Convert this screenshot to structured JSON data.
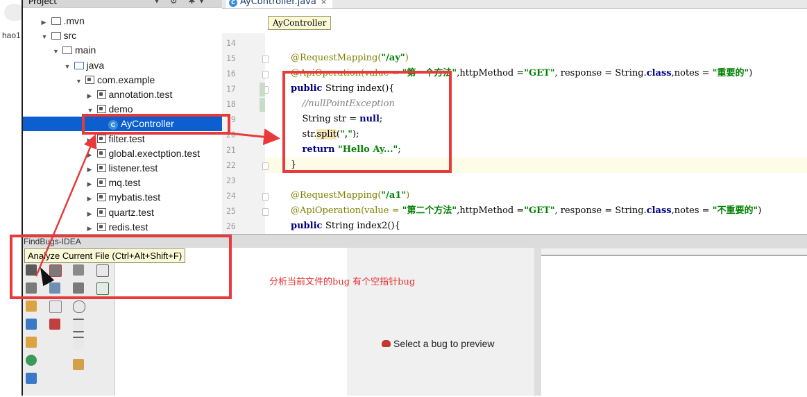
{
  "browser": {
    "partial_label": "hao1"
  },
  "project_panel": {
    "header_title": "Project",
    "header_tools": "▾ ⚙ ✱▾ ⊢",
    "tree": [
      {
        "label": ".mvn",
        "indent": 1,
        "arrow": "▶",
        "icon": "folder"
      },
      {
        "label": "src",
        "indent": 1,
        "arrow": "▼",
        "icon": "folder"
      },
      {
        "label": "main",
        "indent": 2,
        "arrow": "▼",
        "icon": "folder"
      },
      {
        "label": "java",
        "indent": 3,
        "arrow": "▼",
        "icon": "folder-blue"
      },
      {
        "label": "com.example",
        "indent": 4,
        "arrow": "▼",
        "icon": "package"
      },
      {
        "label": "annotation.test",
        "indent": 5,
        "arrow": "▶",
        "icon": "package"
      },
      {
        "label": "demo",
        "indent": 5,
        "arrow": "▼",
        "icon": "package"
      },
      {
        "label": "AyController",
        "indent": 6,
        "arrow": "",
        "icon": "class",
        "selected": true
      },
      {
        "label": "filter.test",
        "indent": 5,
        "arrow": "▶",
        "icon": "package"
      },
      {
        "label": "global.exectption.test",
        "indent": 5,
        "arrow": "▶",
        "icon": "package"
      },
      {
        "label": "listener.test",
        "indent": 5,
        "arrow": "▶",
        "icon": "package"
      },
      {
        "label": "mq.test",
        "indent": 5,
        "arrow": "▶",
        "icon": "package"
      },
      {
        "label": "mybatis.test",
        "indent": 5,
        "arrow": "▶",
        "icon": "package"
      },
      {
        "label": "quartz.test",
        "indent": 5,
        "arrow": "▶",
        "icon": "package"
      },
      {
        "label": "redis.test",
        "indent": 5,
        "arrow": "▶",
        "icon": "package"
      }
    ]
  },
  "editor": {
    "tab_label": "AyController.java",
    "tab_close": "×",
    "tab_icon": "C",
    "breadcrumb_tooltip": "AyController",
    "line_numbers": [
      "14",
      "15",
      "16",
      "17",
      "18",
      "19",
      "20",
      "21",
      "22",
      "23",
      "24",
      "25",
      "26"
    ],
    "code_lines": [
      [],
      [
        {
          "t": "@RequestMapping(",
          "c": "ann"
        },
        {
          "t": "\"/ay\"",
          "c": "str"
        },
        {
          "t": ")",
          "c": "ann"
        }
      ],
      [
        {
          "t": "@ApiOperation(value = ",
          "c": "ann"
        },
        {
          "t": "\"第一个方法\"",
          "c": "str"
        },
        {
          "t": ",httpMethod =",
          "c": ""
        },
        {
          "t": "\"GET\"",
          "c": "str"
        },
        {
          "t": ", response = String.",
          "c": ""
        },
        {
          "t": "class",
          "c": "kw"
        },
        {
          "t": ",notes = ",
          "c": ""
        },
        {
          "t": "\"重要的\"",
          "c": "str"
        },
        {
          "t": ")",
          "c": ""
        }
      ],
      [
        {
          "t": "public ",
          "c": "kw"
        },
        {
          "t": "String index(){",
          "c": ""
        }
      ],
      [
        {
          "t": "    //nullPointException",
          "c": "cmt"
        }
      ],
      [
        {
          "t": "    String str = ",
          "c": ""
        },
        {
          "t": "null",
          "c": "kw"
        },
        {
          "t": ";",
          "c": ""
        }
      ],
      [
        {
          "t": "    str.",
          "c": ""
        },
        {
          "t": "split",
          "c": "split-hl"
        },
        {
          "t": "(",
          "c": ""
        },
        {
          "t": "\",\"",
          "c": "str"
        },
        {
          "t": ");",
          "c": ""
        }
      ],
      [
        {
          "t": "    ",
          "c": ""
        },
        {
          "t": "return ",
          "c": "kw"
        },
        {
          "t": "\"Hello Ay...\"",
          "c": "str"
        },
        {
          "t": ";",
          "c": ""
        }
      ],
      [
        {
          "t": "}",
          "c": ""
        }
      ],
      [],
      [
        {
          "t": "@RequestMapping(",
          "c": "ann"
        },
        {
          "t": "\"/a1\"",
          "c": "str"
        },
        {
          "t": ")",
          "c": "ann"
        }
      ],
      [
        {
          "t": "@ApiOperation(value = ",
          "c": "ann"
        },
        {
          "t": "\"第二个方法\"",
          "c": "str"
        },
        {
          "t": ",httpMethod =",
          "c": ""
        },
        {
          "t": "\"GET\"",
          "c": "str"
        },
        {
          "t": ", response = String.",
          "c": ""
        },
        {
          "t": "class",
          "c": "kw"
        },
        {
          "t": ",notes = ",
          "c": ""
        },
        {
          "t": "\"不重要的\"",
          "c": "str"
        },
        {
          "t": ")",
          "c": ""
        }
      ],
      [
        {
          "t": "public ",
          "c": "kw"
        },
        {
          "t": "String index2(){",
          "c": ""
        }
      ]
    ]
  },
  "findbugs": {
    "header_title": "FindBugs-IDEA",
    "tooltip": "Analyze Current File (Ctrl+Alt+Shift+F)",
    "preview_text": "Select a bug to preview",
    "annotation": "分析当前文件的bug   有个空指针bug"
  },
  "colors": {
    "annotation_red": "#e8393b",
    "selection_blue": "#0d5fcf",
    "string_green": "#008000",
    "keyword_navy": "#000080",
    "annotation_olive": "#808000"
  }
}
